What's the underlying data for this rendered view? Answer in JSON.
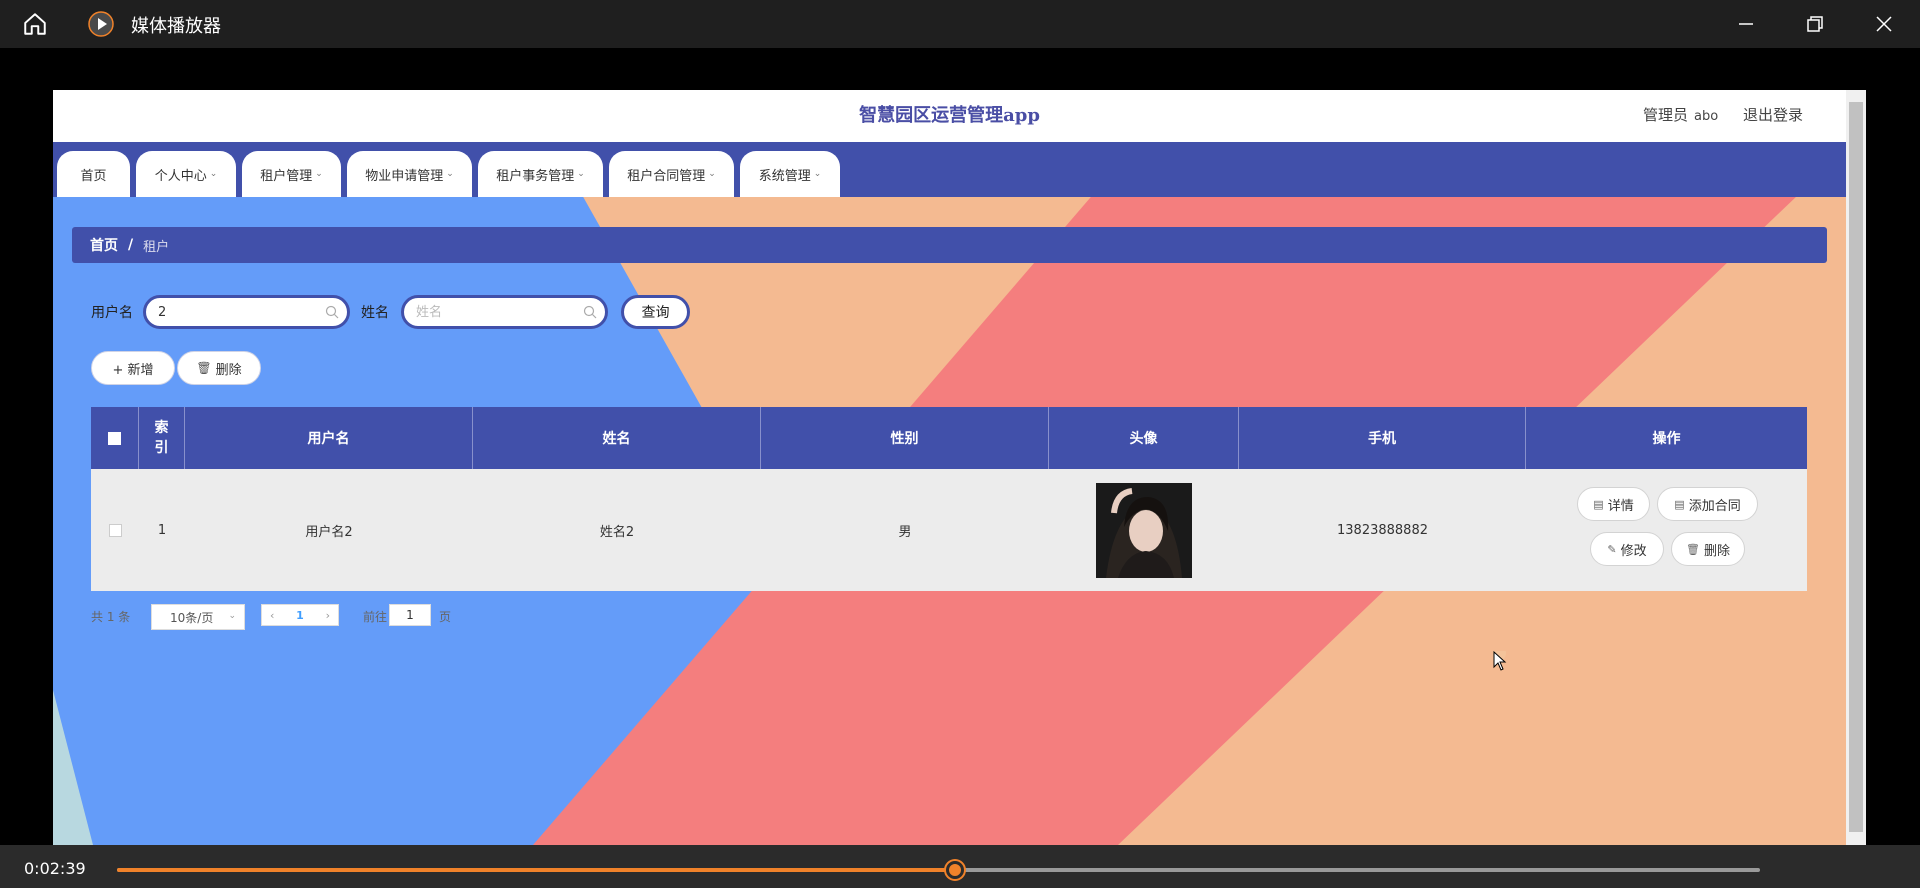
{
  "player": {
    "title": "媒体播放器",
    "time": "0:02:39",
    "progress": 0.51
  },
  "app": {
    "title": "智慧园区运营管理app",
    "header": {
      "role": "管理员",
      "username": "abo",
      "logout": "退出登录"
    },
    "nav": [
      {
        "label": "首页",
        "has_dropdown": false
      },
      {
        "label": "个人中心",
        "has_dropdown": true
      },
      {
        "label": "租户管理",
        "has_dropdown": true
      },
      {
        "label": "物业申请管理",
        "has_dropdown": true
      },
      {
        "label": "租户事务管理",
        "has_dropdown": true
      },
      {
        "label": "租户合同管理",
        "has_dropdown": true
      },
      {
        "label": "系统管理",
        "has_dropdown": true
      }
    ],
    "breadcrumb": {
      "home": "首页",
      "separator": "/",
      "current": "租户"
    },
    "search": {
      "username_label": "用户名",
      "username_value": "2",
      "name_label": "姓名",
      "name_placeholder": "姓名",
      "query_button": "查询"
    },
    "toolbar": {
      "add_label": "+ 新增",
      "delete_label": "删除"
    },
    "table": {
      "columns": [
        "索引",
        "用户名",
        "姓名",
        "性别",
        "头像",
        "手机",
        "操作"
      ],
      "rows": [
        {
          "index": "1",
          "username": "用户名2",
          "name": "姓名2",
          "gender": "男",
          "phone": "13823888882"
        }
      ],
      "actions": {
        "detail": "详情",
        "add_contract": "添加合同",
        "edit": "修改",
        "delete": "删除"
      }
    },
    "pagination": {
      "total_text": "共 1 条",
      "page_size": "10条/页",
      "current_page": "1",
      "goto_label": "前往",
      "goto_value": "1",
      "goto_unit": "页"
    }
  },
  "colors": {
    "primary": "#4150aa",
    "bg_blue": "#649cf9",
    "bg_peach": "#f4ba91",
    "bg_coral": "#f47e7e",
    "progress": "#f0822a"
  }
}
